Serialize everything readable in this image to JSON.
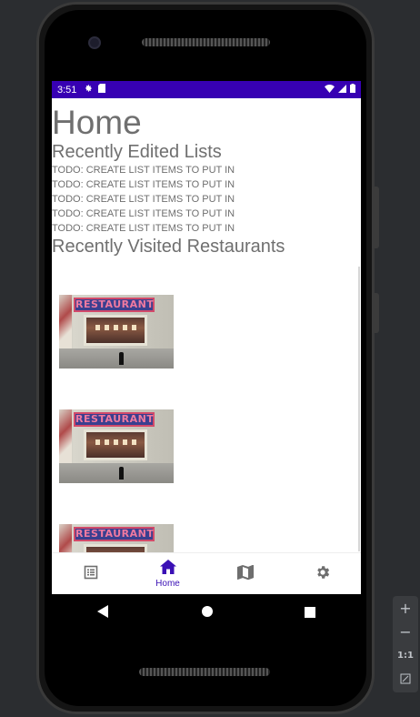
{
  "status_bar": {
    "time": "3:51"
  },
  "home": {
    "title": "Home",
    "recent_lists_title": "Recently Edited Lists",
    "list_items": [
      "TODO: CREATE LIST ITEMS TO PUT IN",
      "TODO: CREATE LIST ITEMS TO PUT IN",
      "TODO: CREATE LIST ITEMS TO PUT IN",
      "TODO: CREATE LIST ITEMS TO PUT IN",
      "TODO: CREATE LIST ITEMS TO PUT IN"
    ],
    "recent_restaurants_title": "Recently Visited Restaurants",
    "restaurant_sign_text": "RESTAURANT"
  },
  "bottom_nav": {
    "lists_icon": "list-icon",
    "home_label": "Home",
    "map_icon": "map-icon",
    "settings_icon": "gear-icon"
  },
  "emulator": {
    "zoom_in": "+",
    "zoom_out": "−",
    "ratio": "1:1"
  },
  "colors": {
    "status_bar": "#3700b3",
    "accent": "#3a10b5",
    "text": "#6f6f6f"
  }
}
